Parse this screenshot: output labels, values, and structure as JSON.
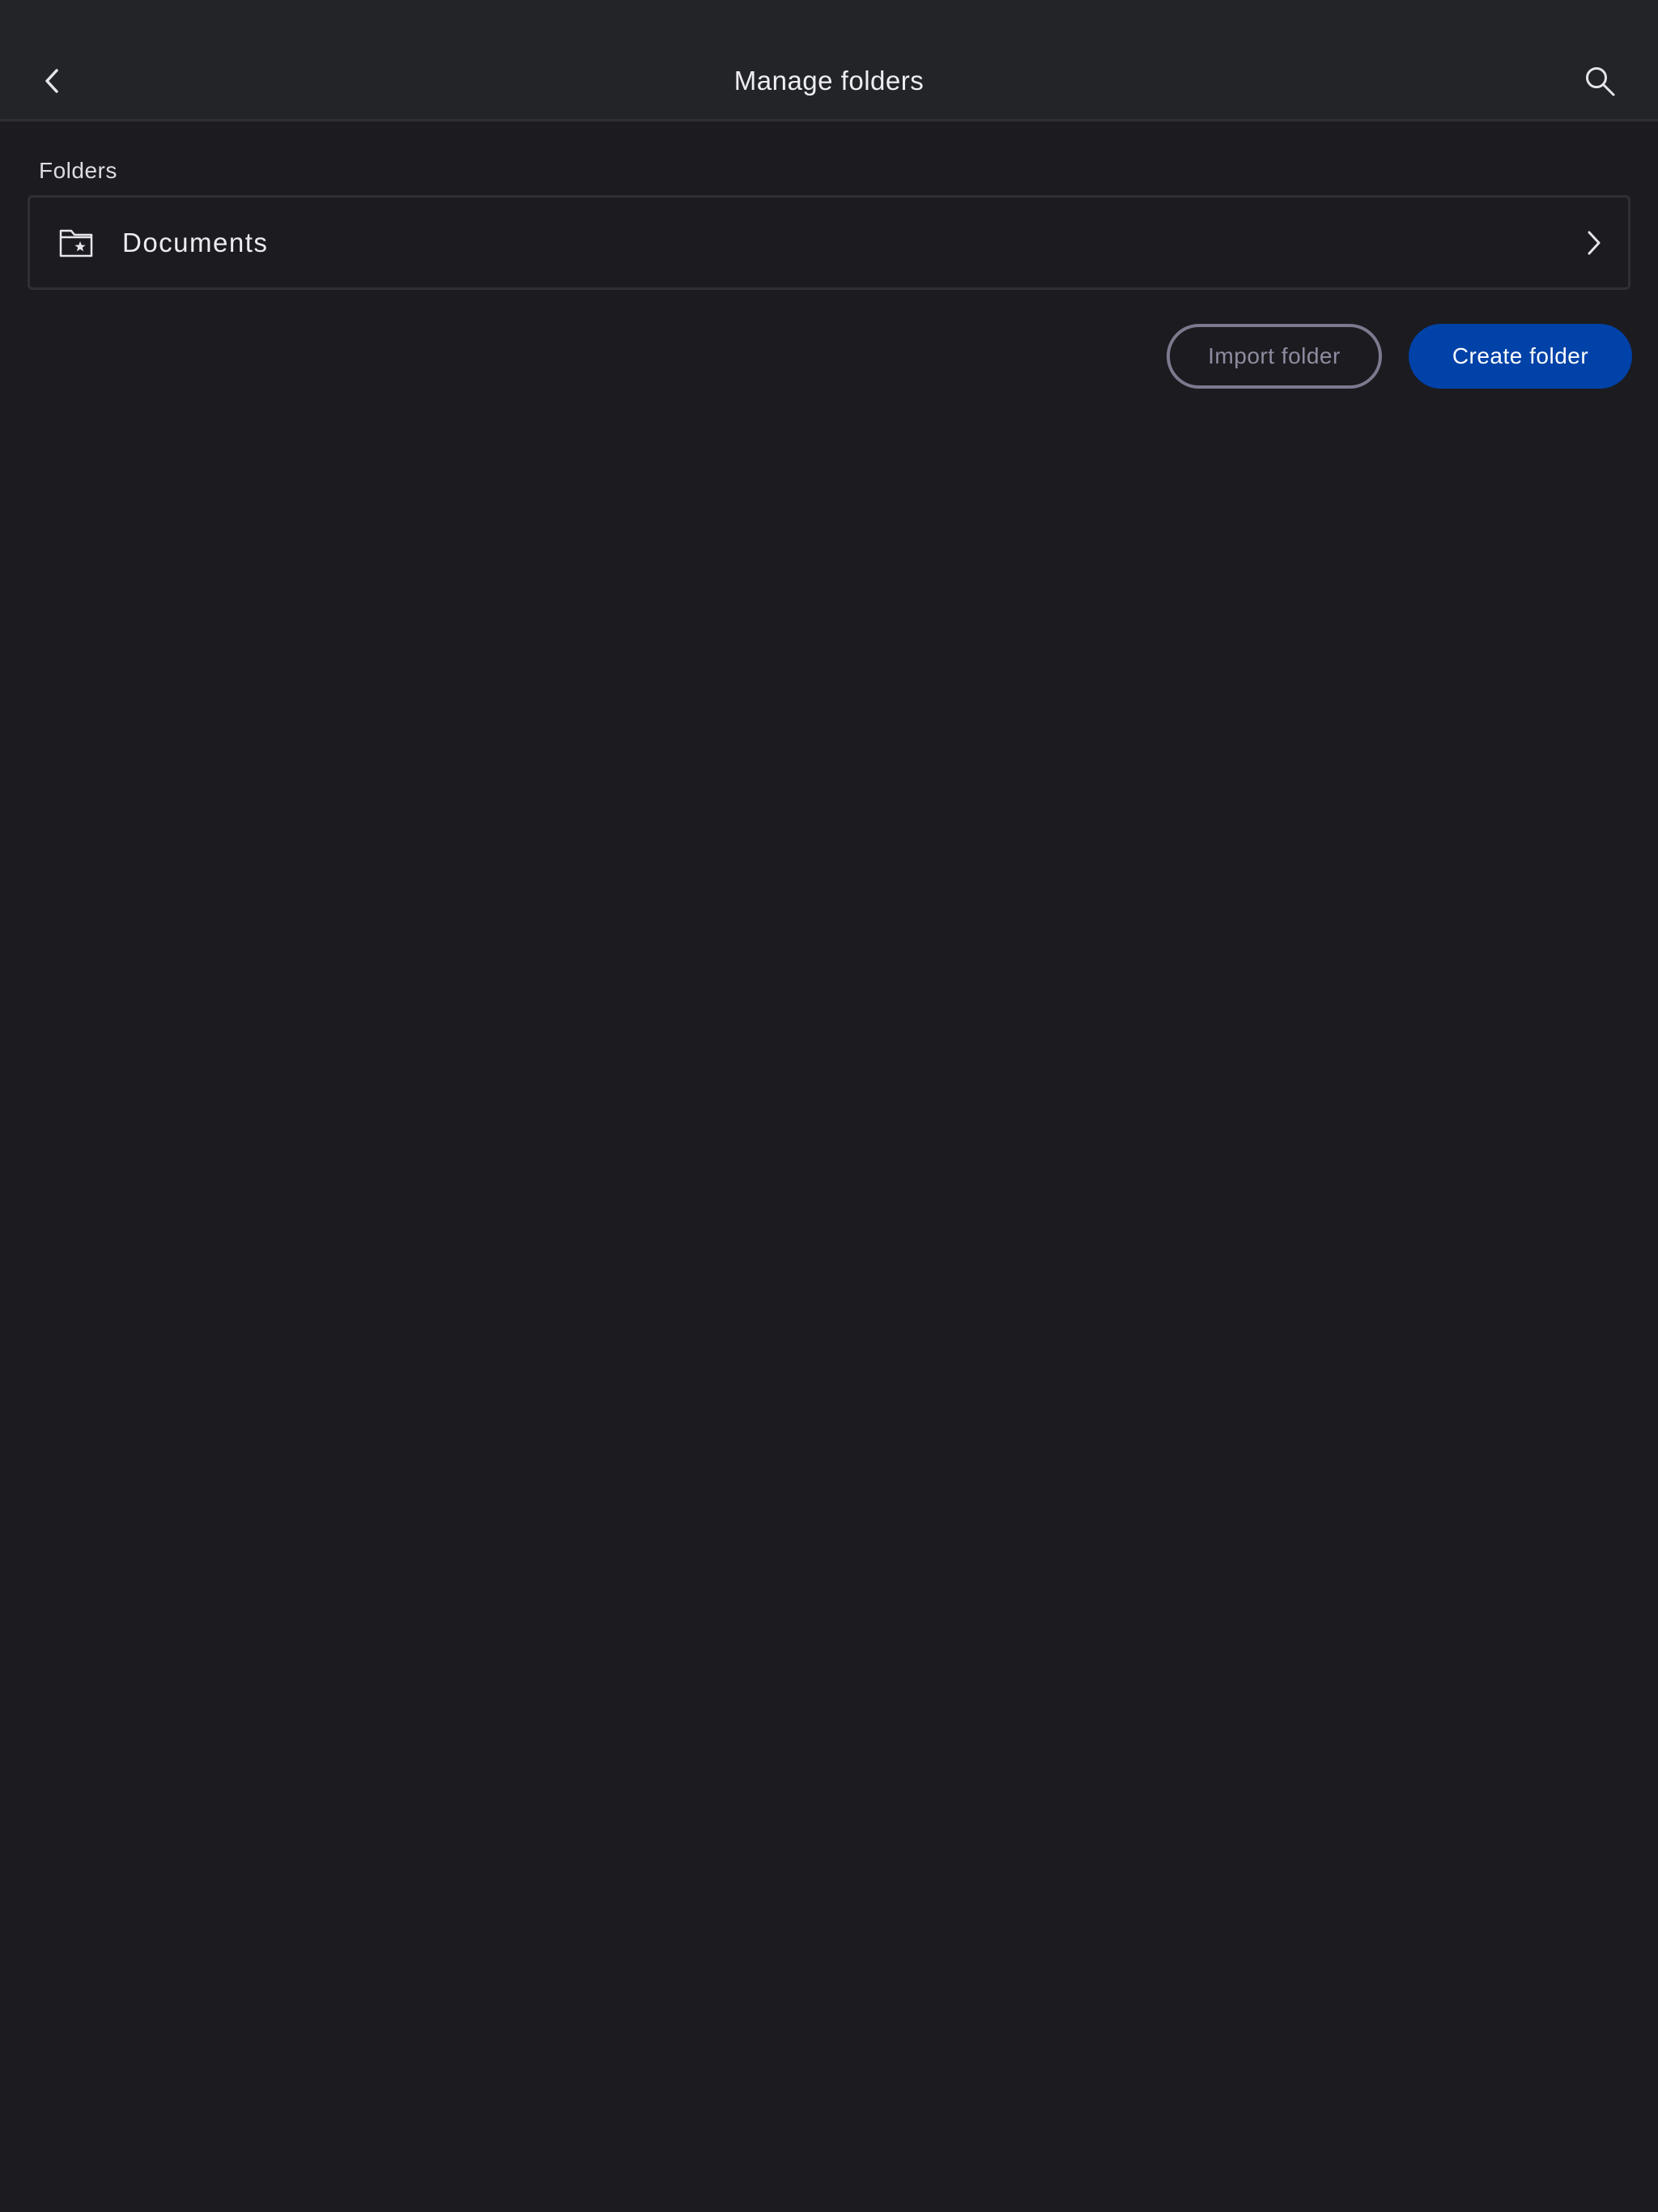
{
  "header": {
    "title": "Manage folders",
    "back_icon": "chevron-left-icon",
    "search_icon": "search-icon"
  },
  "folders": {
    "section_label": "Folders",
    "items": [
      {
        "name": "Documents",
        "icon": "folder-star-icon",
        "trailing_icon": "chevron-right-icon"
      }
    ]
  },
  "actions": {
    "import_label": "Import folder",
    "create_label": "Create folder"
  },
  "colors": {
    "background": "#1c1b20",
    "header_background": "#232428",
    "primary": "#0042a8",
    "outline_button": "#7b7a8e"
  }
}
